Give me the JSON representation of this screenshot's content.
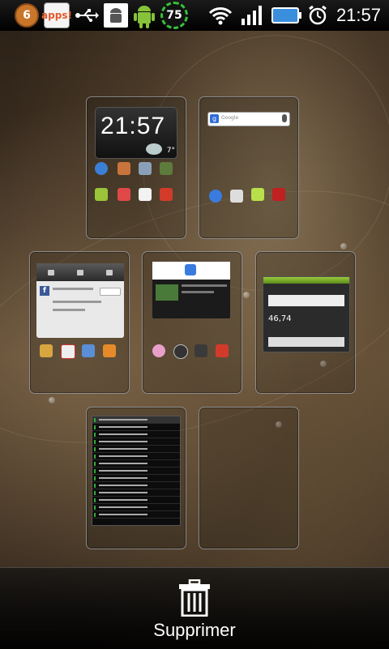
{
  "status_bar": {
    "notification_count": "6",
    "apps_label": "apps!",
    "battery_percent": "75",
    "time": "21:57",
    "icons": [
      "counter-icon",
      "apps-icon",
      "usb-icon",
      "android-debug-icon",
      "android-icon",
      "battery-ring-icon",
      "wifi-icon",
      "signal-icon",
      "battery-icon",
      "alarm-icon"
    ]
  },
  "screens": [
    {
      "id": "screen-1",
      "widget": {
        "time": "21:57",
        "temp": "7°"
      }
    },
    {
      "id": "screen-2",
      "widget": {
        "search_placeholder": "Google"
      }
    },
    {
      "id": "screen-3"
    },
    {
      "id": "screen-4"
    },
    {
      "id": "screen-5",
      "widget": {
        "value": "46,74"
      }
    },
    {
      "id": "screen-6"
    },
    {
      "id": "screen-7"
    }
  ],
  "bottom_bar": {
    "delete_label": "Supprimer"
  }
}
